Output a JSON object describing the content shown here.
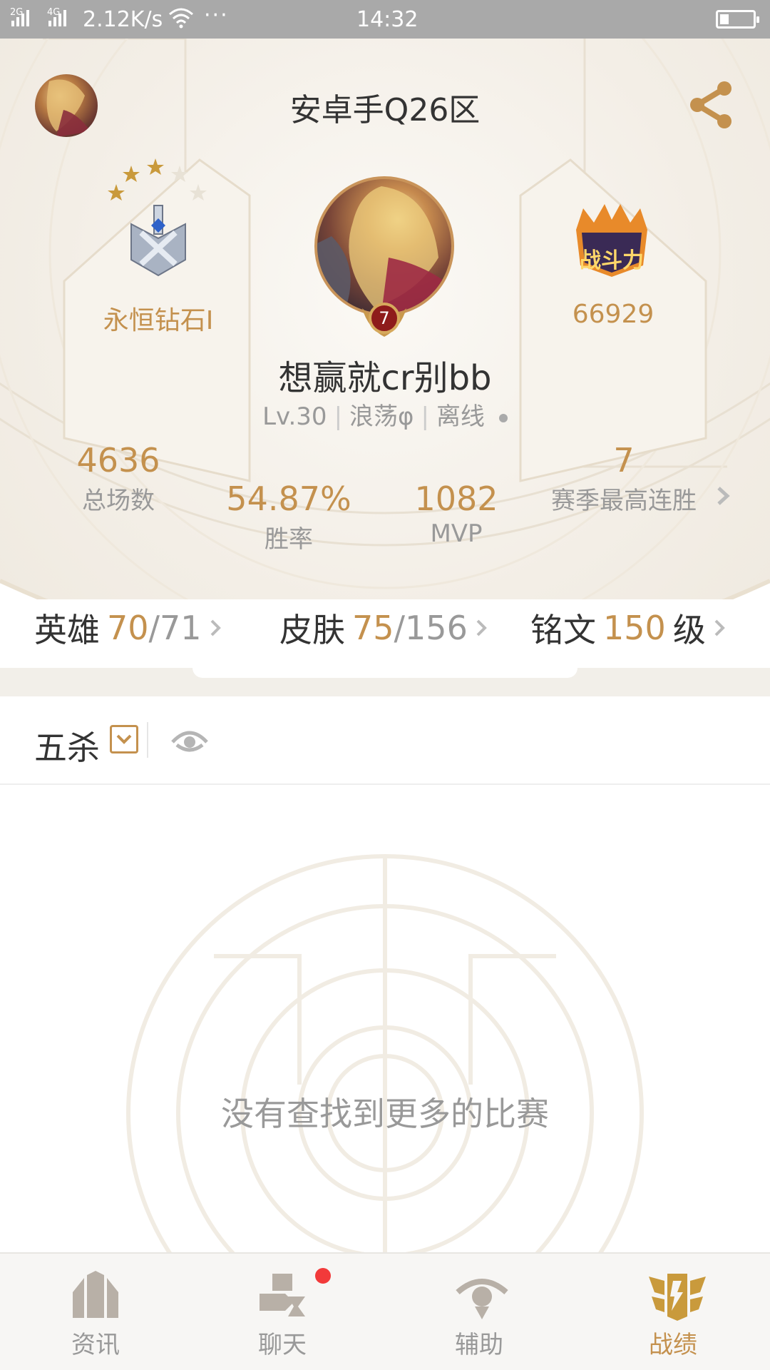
{
  "status_bar": {
    "signal1": "2G",
    "signal2": "4G",
    "speed": "2.12K/s",
    "dots": "···",
    "time": "14:32"
  },
  "header": {
    "server": "安卓手Q26区"
  },
  "profile": {
    "rank_label": "永恒钻石I",
    "level_badge": "7",
    "power_value": "66929",
    "power_emblem_text": "战斗力",
    "name": "想赢就cr别bb",
    "level": "Lv.30",
    "title": "浪荡φ",
    "status": "离线"
  },
  "stats": {
    "total_games": {
      "value": "4636",
      "label": "总场数"
    },
    "win_rate": {
      "value": "54.87%",
      "label": "胜率"
    },
    "mvp": {
      "value": "1082",
      "label": "MVP"
    },
    "best_streak": {
      "value": "7",
      "label": "赛季最高连胜"
    }
  },
  "counts": {
    "heroes": {
      "label": "英雄",
      "owned": "70",
      "total": "/71"
    },
    "skins": {
      "label": "皮肤",
      "owned": "75",
      "total": "/156"
    },
    "runes": {
      "label": "铭文",
      "value": "150",
      "unit": "级"
    }
  },
  "filter": {
    "label": "五杀"
  },
  "empty_message": "没有查找到更多的比赛",
  "nav": {
    "items": [
      {
        "label": "资讯",
        "icon": "news-icon"
      },
      {
        "label": "聊天",
        "icon": "chat-icon"
      },
      {
        "label": "辅助",
        "icon": "assist-icon"
      },
      {
        "label": "战绩",
        "icon": "record-icon"
      }
    ],
    "active_index": 3
  },
  "colors": {
    "accent": "#c4914e",
    "muted": "#999999",
    "notification": "#f23a3a"
  }
}
